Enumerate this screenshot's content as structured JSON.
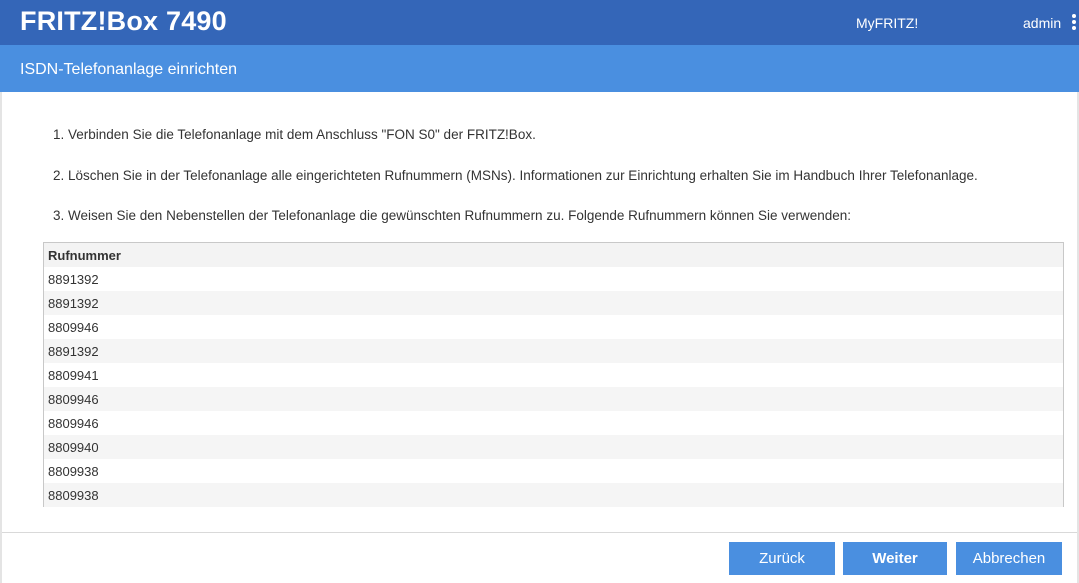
{
  "header": {
    "brand": "FRITZ!Box 7490",
    "myfritz": "MyFRITZ!",
    "user": "admin",
    "menu_icon": "kebab-menu-icon"
  },
  "page": {
    "title": "ISDN-Telefonanlage einrichten"
  },
  "steps": [
    "1. Verbinden Sie die Telefonanlage mit dem Anschluss \"FON S0\" der FRITZ!Box.",
    "2. Löschen Sie in der Telefonanlage alle eingerichteten Rufnummern (MSNs). Informationen zur Einrichtung erhalten Sie im Handbuch Ihrer Telefonanlage.",
    "3. Weisen Sie den Nebenstellen der Telefonanlage die gewünschten Rufnummern zu. Folgende Rufnummern können Sie verwenden:"
  ],
  "table": {
    "header": "Rufnummer",
    "rows": [
      "8891392",
      "8891392",
      "8809946",
      "8891392",
      "8809941",
      "8809946",
      "8809946",
      "8809940",
      "8809938",
      "8809938"
    ]
  },
  "buttons": {
    "back": "Zurück",
    "next": "Weiter",
    "cancel": "Abbrechen"
  },
  "colors": {
    "topbar": "#3466b8",
    "subbar": "#4a8fe0",
    "button": "#4a8fe0"
  }
}
